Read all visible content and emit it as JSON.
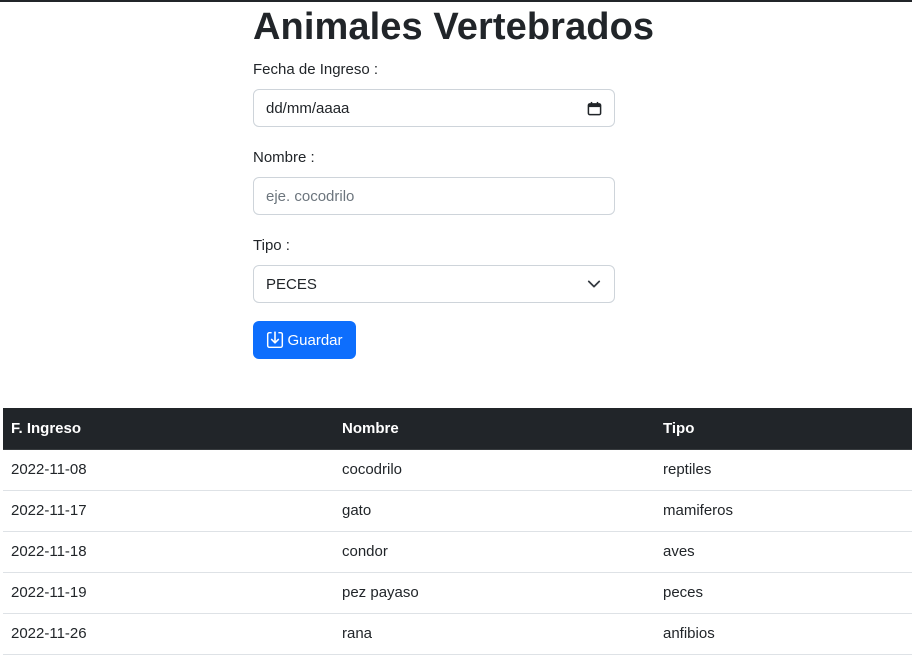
{
  "page": {
    "title": "Animales Vertebrados"
  },
  "form": {
    "fecha_label": "Fecha de Ingreso :",
    "fecha_value": "dd/mm/aaaa",
    "nombre_label": "Nombre :",
    "nombre_placeholder": "eje. cocodrilo",
    "tipo_label": "Tipo :",
    "tipo_selected": "PECES",
    "save_label": "Guardar",
    "icons": {
      "date": "calendar-icon",
      "select": "chevron-down-icon",
      "save": "download-box-icon"
    }
  },
  "table": {
    "headers": [
      "F. Ingreso",
      "Nombre",
      "Tipo"
    ],
    "rows": [
      [
        "2022-11-08",
        "cocodrilo",
        "reptiles"
      ],
      [
        "2022-11-17",
        "gato",
        "mamiferos"
      ],
      [
        "2022-11-18",
        "condor",
        "aves"
      ],
      [
        "2022-11-19",
        "pez payaso",
        "peces"
      ],
      [
        "2022-11-26",
        "rana",
        "anfibios"
      ]
    ]
  },
  "colors": {
    "primary": "#0d6efd",
    "table_header": "#212529"
  }
}
